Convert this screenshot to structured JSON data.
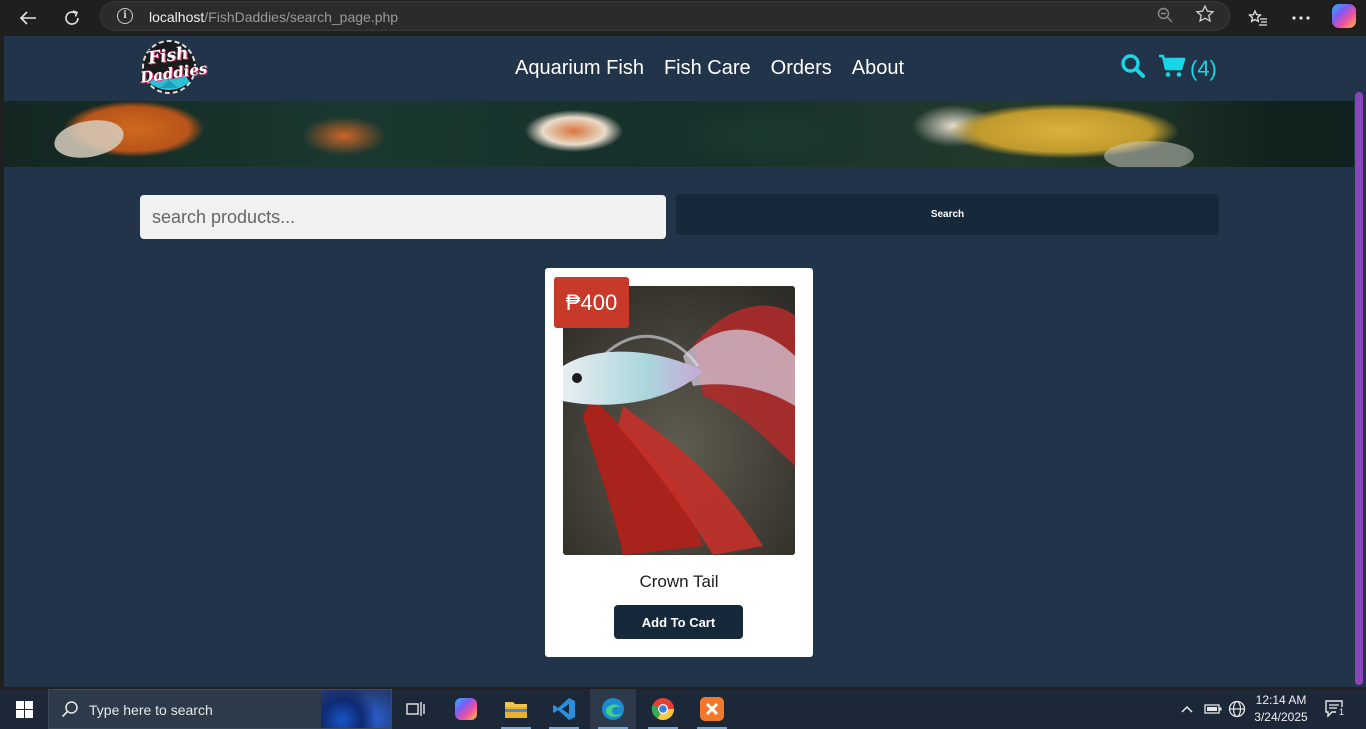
{
  "browser": {
    "url_host": "localhost",
    "url_path": "/FishDaddies/search_page.php"
  },
  "site": {
    "logo_line1": "Fish",
    "logo_line2": "Daddies",
    "nav": [
      "Aquarium Fish",
      "Fish Care",
      "Orders",
      "About"
    ],
    "cart_count": "(4)"
  },
  "search": {
    "placeholder": "search products...",
    "button_label": "Search"
  },
  "products": [
    {
      "price": "₱400",
      "name": "Crown Tail",
      "button_label": "Add To Cart"
    }
  ],
  "taskbar": {
    "search_placeholder": "Type here to search",
    "time": "12:14 AM",
    "date": "3/24/2025",
    "notification_count": "1"
  },
  "colors": {
    "page_bg": "#223449",
    "accent_cyan": "#19d6e6",
    "price_badge": "#c73a2a",
    "dark_button": "#16293a",
    "scrollbar": "#8a45b8"
  }
}
